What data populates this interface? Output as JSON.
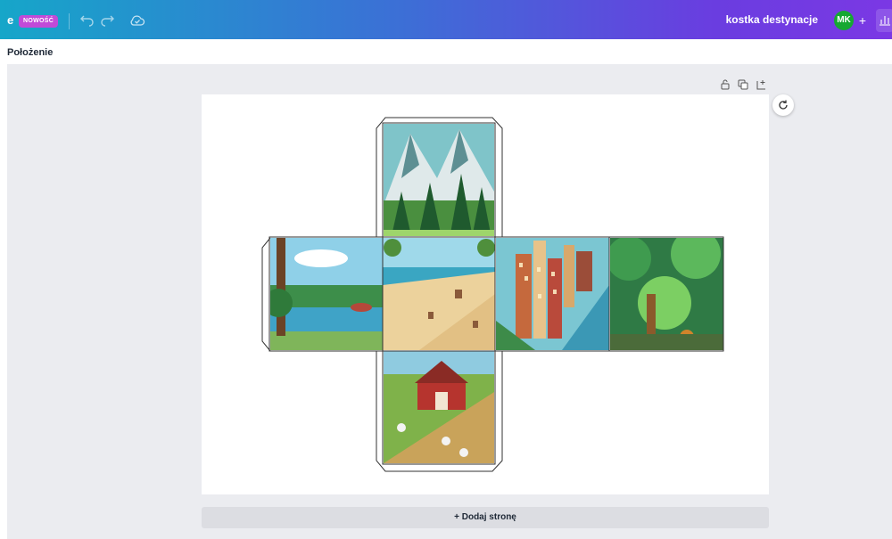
{
  "topbar": {
    "left_letter": "e",
    "new_badge": "NOWOŚĆ",
    "doc_title": "kostka destynacje",
    "avatar_initials": "MK",
    "add_label": "+",
    "icons": [
      "undo-icon",
      "redo-icon",
      "cloud-save-icon",
      "insights-icon"
    ]
  },
  "toolbar": {
    "position_label": "Położenie"
  },
  "page_tools": {
    "icons": [
      "lock-icon",
      "duplicate-icon",
      "add-page-icon"
    ]
  },
  "canvas": {
    "faces": [
      {
        "name": "face-mountains",
        "scene": "mountains"
      },
      {
        "name": "face-lake",
        "scene": "lake"
      },
      {
        "name": "face-beach",
        "scene": "beach"
      },
      {
        "name": "face-city",
        "scene": "city"
      },
      {
        "name": "face-forest",
        "scene": "forest"
      },
      {
        "name": "face-farm",
        "scene": "farm"
      }
    ],
    "refresh_icon": "refresh-icon",
    "add_page_label": "+ Dodaj stronę"
  },
  "colors": {
    "gradient_start": "#16a6c9",
    "gradient_end": "#7b38e4",
    "avatar": "#15a832",
    "badge": "#c14ad8",
    "workspace": "#ebecf0"
  }
}
